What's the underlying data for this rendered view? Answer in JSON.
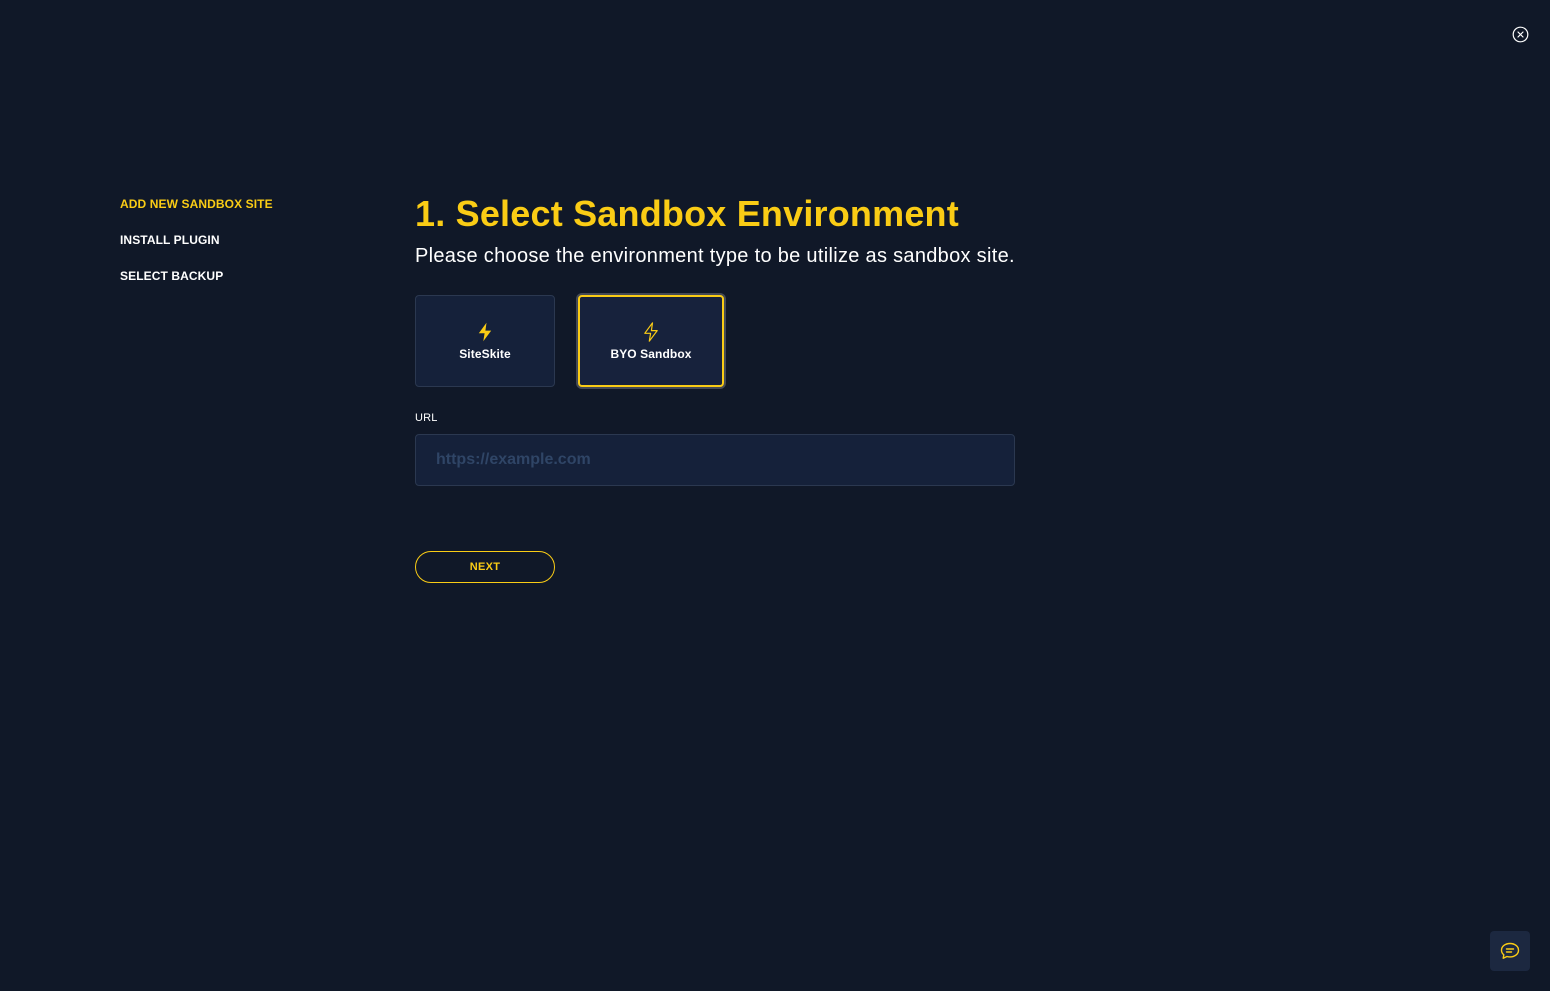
{
  "close": {
    "icon": "close-circle-icon"
  },
  "steps": [
    {
      "label": "ADD NEW SANDBOX SITE",
      "active": true
    },
    {
      "label": "INSTALL PLUGIN",
      "active": false
    },
    {
      "label": "SELECT BACKUP",
      "active": false
    }
  ],
  "main": {
    "title": "1. Select Sandbox Environment",
    "subtitle": "Please choose the environment type to be utilize as sandbox site."
  },
  "environments": [
    {
      "label": "SiteSkite",
      "icon": "lightning-bolt-filled-icon",
      "selected": false
    },
    {
      "label": "BYO Sandbox",
      "icon": "lightning-bolt-outline-icon",
      "selected": true
    }
  ],
  "url_field": {
    "label": "URL",
    "value": "",
    "placeholder": "https://example.com"
  },
  "next_button": {
    "label": "NEXT"
  },
  "chat": {
    "icon": "chat-bubble-icon"
  },
  "colors": {
    "background": "#101828",
    "accent": "#FACC15",
    "card": "#15213a",
    "border": "#2b3850"
  }
}
